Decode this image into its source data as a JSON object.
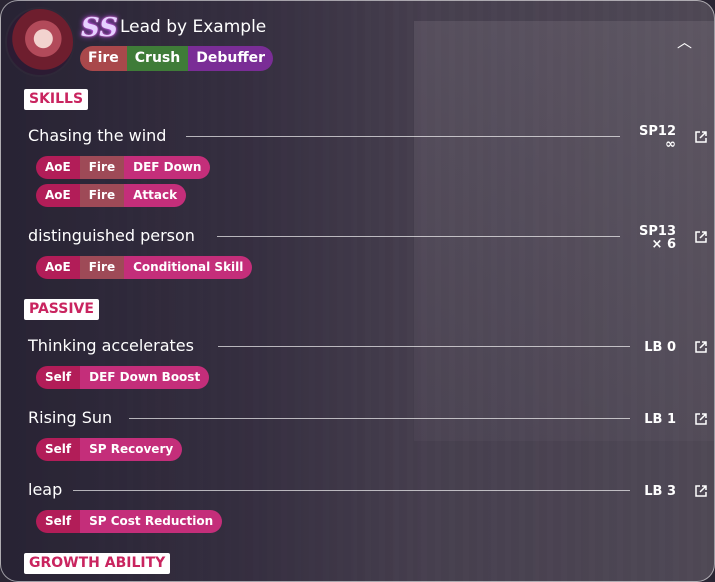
{
  "header": {
    "rank": "SS",
    "title": "Lead by Example",
    "tags": [
      "Fire",
      "Crush",
      "Debuffer"
    ],
    "collapse_icon": "chevron-up-icon"
  },
  "sections": {
    "skills": "SKILLS",
    "passive": "PASSIVE",
    "growth": "GROWTH ABILITY"
  },
  "skills": [
    {
      "name": "Chasing the wind",
      "sp": "SP12",
      "uses": "∞",
      "effects": [
        [
          "AoE",
          "Fire",
          "DEF Down"
        ],
        [
          "AoE",
          "Fire",
          "Attack"
        ]
      ]
    },
    {
      "name": "distinguished person",
      "sp": "SP13",
      "uses": "× 6",
      "effects": [
        [
          "AoE",
          "Fire",
          "Conditional Skill"
        ]
      ]
    }
  ],
  "passives": [
    {
      "name": "Thinking accelerates",
      "lb": "LB 0",
      "effects": [
        "Self",
        "DEF Down Boost"
      ]
    },
    {
      "name": "Rising Sun",
      "lb": "LB 1",
      "effects": [
        "Self",
        "SP Recovery"
      ]
    },
    {
      "name": "leap",
      "lb": "LB 3",
      "effects": [
        "Self",
        "SP Cost Reduction"
      ]
    }
  ]
}
